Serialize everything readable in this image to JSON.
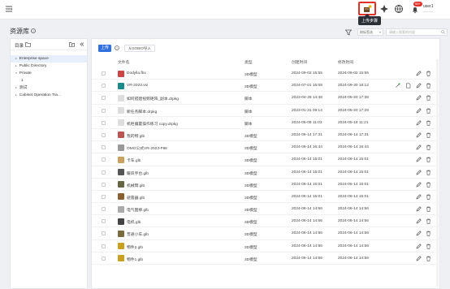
{
  "topbar": {
    "tooltip": "上传步骤",
    "badge": "99+",
    "user_name": "user1",
    "user_sub": "———",
    "accent": "#e0322b"
  },
  "page": {
    "title": "资源库",
    "filter_select": "按标签选",
    "search_placeholder": "请输入搜索的内容"
  },
  "sidebar": {
    "header": "目录",
    "items": [
      {
        "label": "Enterprise space",
        "level": 1,
        "arrow": "▸",
        "selected": true
      },
      {
        "label": "Public Directory",
        "level": 1,
        "arrow": "▸",
        "selected": false
      },
      {
        "label": "Private",
        "level": 1,
        "arrow": "▾",
        "selected": false
      },
      {
        "label": "1",
        "level": 2,
        "arrow": "",
        "selected": false
      },
      {
        "label": "测试",
        "level": 1,
        "arrow": "▸",
        "selected": false
      },
      {
        "label": "Cabinet Operation Tra...",
        "level": 1,
        "arrow": "▸",
        "selected": false
      }
    ]
  },
  "toolbar": {
    "upload_label": "上传",
    "import_label": "从SOBIO导入"
  },
  "table": {
    "columns": [
      "文件名",
      "类型",
      "创建时间",
      "修改时间"
    ],
    "rows": [
      {
        "name": "Dodylla.fbx",
        "type": "3D模型",
        "created": "2024-09-02 15:55",
        "modified": "2024-09-02 15:55",
        "icon": "#c44"
      },
      {
        "name": "VR-2023.vsi",
        "type": "3D模型",
        "created": "2024-07-01 16:08",
        "modified": "2024-09-30 18:12",
        "icon": "#1a8a8a"
      },
      {
        "name": "如何搭建视频矩阵_副本.drpkg",
        "type": "脚本",
        "created": "2023-04-28 14:48",
        "modified": "2024-05-20 17:38",
        "icon": "#ddd"
      },
      {
        "name": "新任务脚本.drpkg",
        "type": "脚本",
        "created": "2023-01-31 09:14",
        "modified": "2024-05-20 17:29",
        "icon": "#ddd"
      },
      {
        "name": "机柜偏置操作练习 copy.drpkg",
        "type": "脚本",
        "created": "2024-05-08 11:03",
        "modified": "2024-05-18 11:21",
        "icon": "#ddd"
      },
      {
        "name": "我的物.glb",
        "type": "3D模型",
        "created": "2024-06-14 17:31",
        "modified": "2024-06-14 17:31",
        "icon": "#b55"
      },
      {
        "name": "OMG公式VR-2023-F86",
        "type": "3D模型",
        "created": "2024-06-14 16:44",
        "modified": "2024-06-14 16:44",
        "icon": "#999"
      },
      {
        "name": "卡车.glb",
        "type": "3D模型",
        "created": "2024-06-14 15:01",
        "modified": "2024-06-14 15:01",
        "icon": "#c8a060"
      },
      {
        "name": "暖风手台.glb",
        "type": "3D模型",
        "created": "2024-06-14 15:01",
        "modified": "2024-06-14 15:01",
        "icon": "#555"
      },
      {
        "name": "机械臂.glb",
        "type": "3D模型",
        "created": "2024-06-14 15:01",
        "modified": "2024-06-14 15:01",
        "icon": "#664"
      },
      {
        "name": "避雷器.glb",
        "type": "3D模型",
        "created": "2024-06-14 15:01",
        "modified": "2024-06-14 15:01",
        "icon": "#8a6030"
      },
      {
        "name": "电气图柳.glb",
        "type": "3D模型",
        "created": "2024-06-14 14:56",
        "modified": "2024-06-14 14:56",
        "icon": "#aaa"
      },
      {
        "name": "电机.glb",
        "type": "3D模型",
        "created": "2024-06-14 14:56",
        "modified": "2024-06-14 14:56",
        "icon": "#444"
      },
      {
        "name": "普通小车.glb",
        "type": "3D模型",
        "created": "2024-06-14 14:56",
        "modified": "2024-06-14 14:56",
        "icon": "#7a6a40"
      },
      {
        "name": "物件2.glb",
        "type": "3D模型",
        "created": "2024-06-14 14:56",
        "modified": "2024-06-14 14:56",
        "icon": "#c9a020"
      },
      {
        "name": "物件1.glb",
        "type": "3D模型",
        "created": "2024-06-14 14:56",
        "modified": "2024-06-14 14:56",
        "icon": "#c9a020"
      }
    ]
  }
}
